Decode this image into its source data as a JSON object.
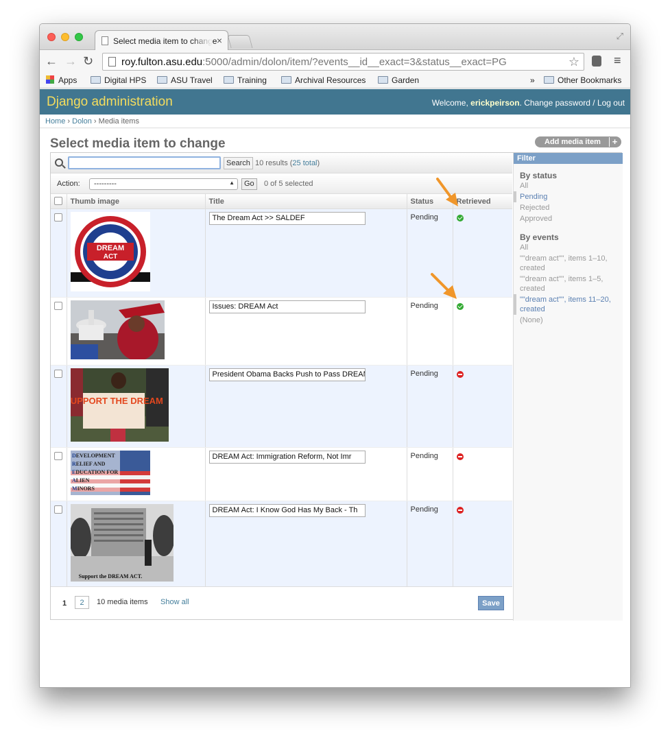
{
  "browser": {
    "tab_title": "Select media item to change",
    "url_host": "roy.fulton.asu.edu",
    "url_rest": ":5000/admin/dolon/item/?events__id__exact=3&status__exact=PG",
    "bookmarks": [
      "Apps",
      "Digital HPS",
      "ASU Travel",
      "Training",
      "Archival Resources",
      "Garden"
    ],
    "bookmarks_overflow": "»",
    "other_bookmarks": "Other Bookmarks"
  },
  "admin": {
    "brand": "Django administration",
    "welcome": "Welcome, ",
    "username": "erickpeirson",
    "change_password": "Change password",
    "separator": " / ",
    "logout": "Log out"
  },
  "breadcrumbs": [
    "Home",
    "Dolon",
    "Media items"
  ],
  "page": {
    "title": "Select media item to change",
    "add_button": "Add media item",
    "add_plus": "+"
  },
  "search": {
    "value": "",
    "button": "Search",
    "results": "10 results (",
    "total_link": "25 total",
    "results_end": ")"
  },
  "actions": {
    "label": "Action:",
    "selected": "---------",
    "go": "Go",
    "count": "0 of 5 selected"
  },
  "table": {
    "headers": [
      "Thumb image",
      "Title",
      "Status",
      "Retrieved"
    ],
    "rows": [
      {
        "title": "The Dream Act >> SALDEF",
        "status": "Pending",
        "retrieved": true
      },
      {
        "title": "Issues: DREAM Act",
        "status": "Pending",
        "retrieved": true
      },
      {
        "title": "President Obama Backs Push to Pass DREAM",
        "status": "Pending",
        "retrieved": false
      },
      {
        "title": "DREAM Act: Immigration Reform, Not Imr",
        "status": "Pending",
        "retrieved": false
      },
      {
        "title": "DREAM Act: I Know God Has My Back - Th",
        "status": "Pending",
        "retrieved": false
      }
    ]
  },
  "thumbs": {
    "dream_top": "DREAM",
    "dream_bottom": "ACT",
    "support": "SUPPORT THE DREAM",
    "acronym": [
      "EVELOPMENT",
      "ELIEF AND",
      "DUCATION FOR",
      "LIEN",
      "INORS"
    ],
    "acronym_letters": [
      "D",
      "R",
      "E",
      "A",
      "M"
    ],
    "support_caption": "Support the DREAM ACT."
  },
  "paginator": {
    "current": "1",
    "next": "2",
    "count": "10 media items",
    "show_all": "Show all",
    "save": "Save"
  },
  "filter": {
    "heading": "Filter",
    "by_status": "By status",
    "status_options": [
      "All",
      "Pending",
      "Rejected",
      "Approved"
    ],
    "by_events": "By events",
    "event_options": [
      "All",
      "\"\"dream act\"\", items 1–10, created",
      "\"\"dream act\"\", items 1–5, created",
      "\"\"dream act\"\", items 11–20, created",
      "(None)"
    ]
  },
  "colors": {
    "header": "#417690",
    "brand": "#f5dd5d",
    "arrow": "#f0962a",
    "ok": "#33aa33",
    "no": "#dd2222"
  }
}
